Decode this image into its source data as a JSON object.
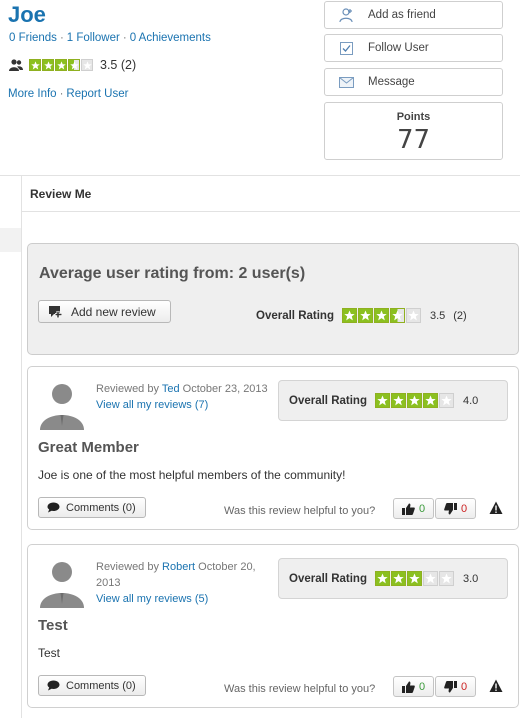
{
  "profile": {
    "name": "Joe",
    "friends_link": "0 Friends",
    "followers_link": "1 Follower",
    "achievements_link": "0 Achievements",
    "rating_value": "3.5",
    "rating_count": "(2)",
    "rating_stars": 3.5,
    "more_info": "More Info",
    "report_user": "Report User"
  },
  "actions": {
    "add_friend": "Add as friend",
    "follow_user": "Follow User",
    "message": "Message",
    "points_label": "Points",
    "points_value": "77"
  },
  "section": {
    "title": "Review Me"
  },
  "summary": {
    "title": "Average user rating from: 2 user(s)",
    "add_review": "Add new review",
    "overall_label": "Overall Rating",
    "overall_value": "3.5",
    "overall_count": "(2)",
    "overall_stars": 3.5
  },
  "reviews": [
    {
      "reviewed_by": "Reviewed by",
      "reviewer": "Ted",
      "date": "October 23, 2013",
      "view_all": "View all my reviews (7)",
      "overall_label": "Overall Rating",
      "rating_value": "4.0",
      "rating_stars": 4,
      "title": "Great Member",
      "body": "Joe is one of the most helpful members of the community!",
      "comments": "Comments (0)",
      "helpful_question": "Was this review helpful to you?",
      "up_count": "0",
      "down_count": "0"
    },
    {
      "reviewed_by": "Reviewed by",
      "reviewer": "Robert",
      "date": "October 20, 2013",
      "view_all": "View all my reviews (5)",
      "overall_label": "Overall Rating",
      "rating_value": "3.0",
      "rating_stars": 3,
      "title": "Test",
      "body": "Test",
      "comments": "Comments (0)",
      "helpful_question": "Was this review helpful to you?",
      "up_count": "0",
      "down_count": "0"
    }
  ],
  "colors": {
    "link": "#1a73b0",
    "star_fill": "#8bc020",
    "star_empty": "#e6e6e6",
    "upvote": "#3a9a3a",
    "downvote": "#cc2222"
  }
}
